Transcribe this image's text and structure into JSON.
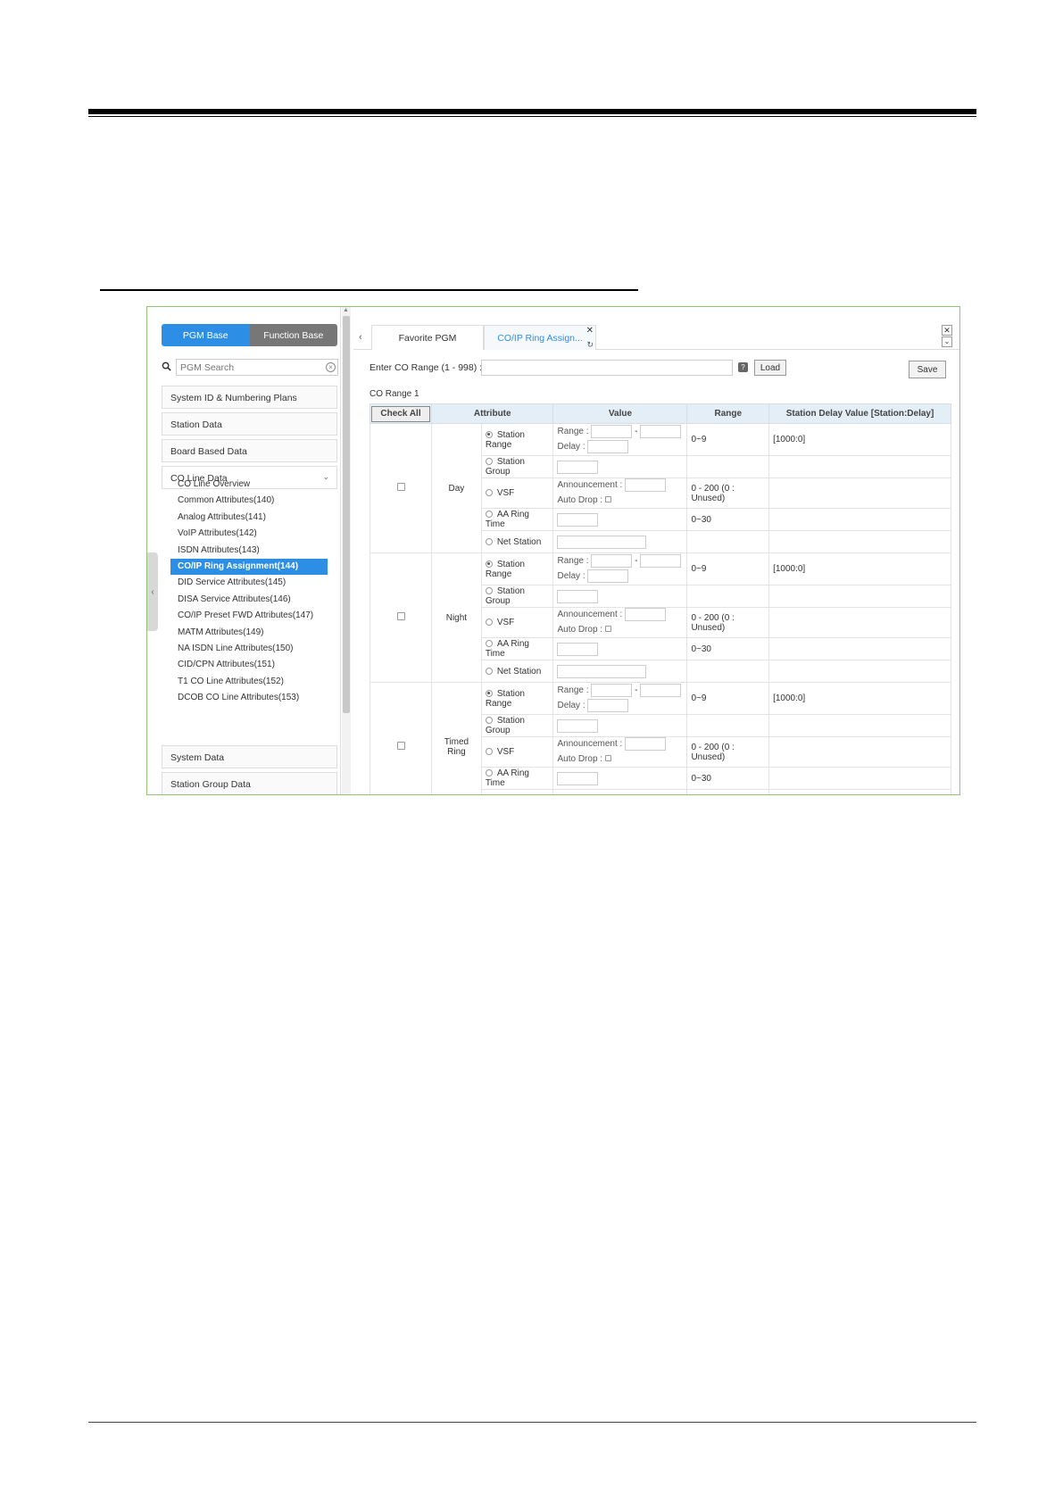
{
  "sidebar": {
    "mode_tabs": [
      "PGM Base",
      "Function Base"
    ],
    "search_placeholder": "PGM Search",
    "groups": {
      "system_id": "System ID & Numbering Plans",
      "station_data": "Station Data",
      "board_based": "Board Based Data",
      "co_line": "CO Line Data",
      "system_data": "System Data",
      "station_group": "Station Group Data"
    },
    "co_items": [
      "CO Line Overview",
      "Common Attributes(140)",
      "Analog Attributes(141)",
      "VoIP Attributes(142)",
      "ISDN Attributes(143)",
      "CO/IP Ring Assignment(144)",
      "DID Service Attributes(145)",
      "DISA Service Attributes(146)",
      "CO/IP Preset FWD Attributes(147)",
      "MATM Attributes(149)",
      "NA ISDN Line Attributes(150)",
      "CID/CPN Attributes(151)",
      "T1 CO Line Attributes(152)",
      "DCOB CO Line Attributes(153)"
    ],
    "active_item": "CO/IP Ring Assignment(144)"
  },
  "tabs": {
    "favorite": "Favorite PGM",
    "current": "CO/IP Ring Assign..."
  },
  "form": {
    "range_label": "Enter CO Range (1 - 998) :",
    "help": "?",
    "load": "Load",
    "save": "Save",
    "co_range_title": "CO Range 1"
  },
  "table": {
    "check_all": "Check All",
    "headers": {
      "attribute": "Attribute",
      "value": "Value",
      "range": "Range",
      "delay": "Station Delay Value [Station:Delay]"
    },
    "labels": {
      "station_range": "Station Range",
      "station_group": "Station Group",
      "vsf": "VSF",
      "aa_ring_time": "AA Ring Time",
      "net_station": "Net Station",
      "range": "Range :",
      "dash": "-",
      "delay": "Delay :",
      "announcement": "Announcement :",
      "auto_drop": "Auto Drop :"
    },
    "sections": [
      {
        "name": "Day",
        "station_range_range": "0~9",
        "delay_value": "[1000:0]",
        "vsf_range": "0 - 200 (0 : Unused)",
        "aa_range": "0~30"
      },
      {
        "name": "Night",
        "station_range_range": "0~9",
        "delay_value": "[1000:0]",
        "vsf_range": "0 - 200 (0 : Unused)",
        "aa_range": "0~30"
      },
      {
        "name": "Timed Ring",
        "station_range_range": "0~9",
        "delay_value": "[1000:0]",
        "vsf_range": "0 - 200 (0 : Unused)",
        "aa_range": "0~30"
      }
    ]
  }
}
